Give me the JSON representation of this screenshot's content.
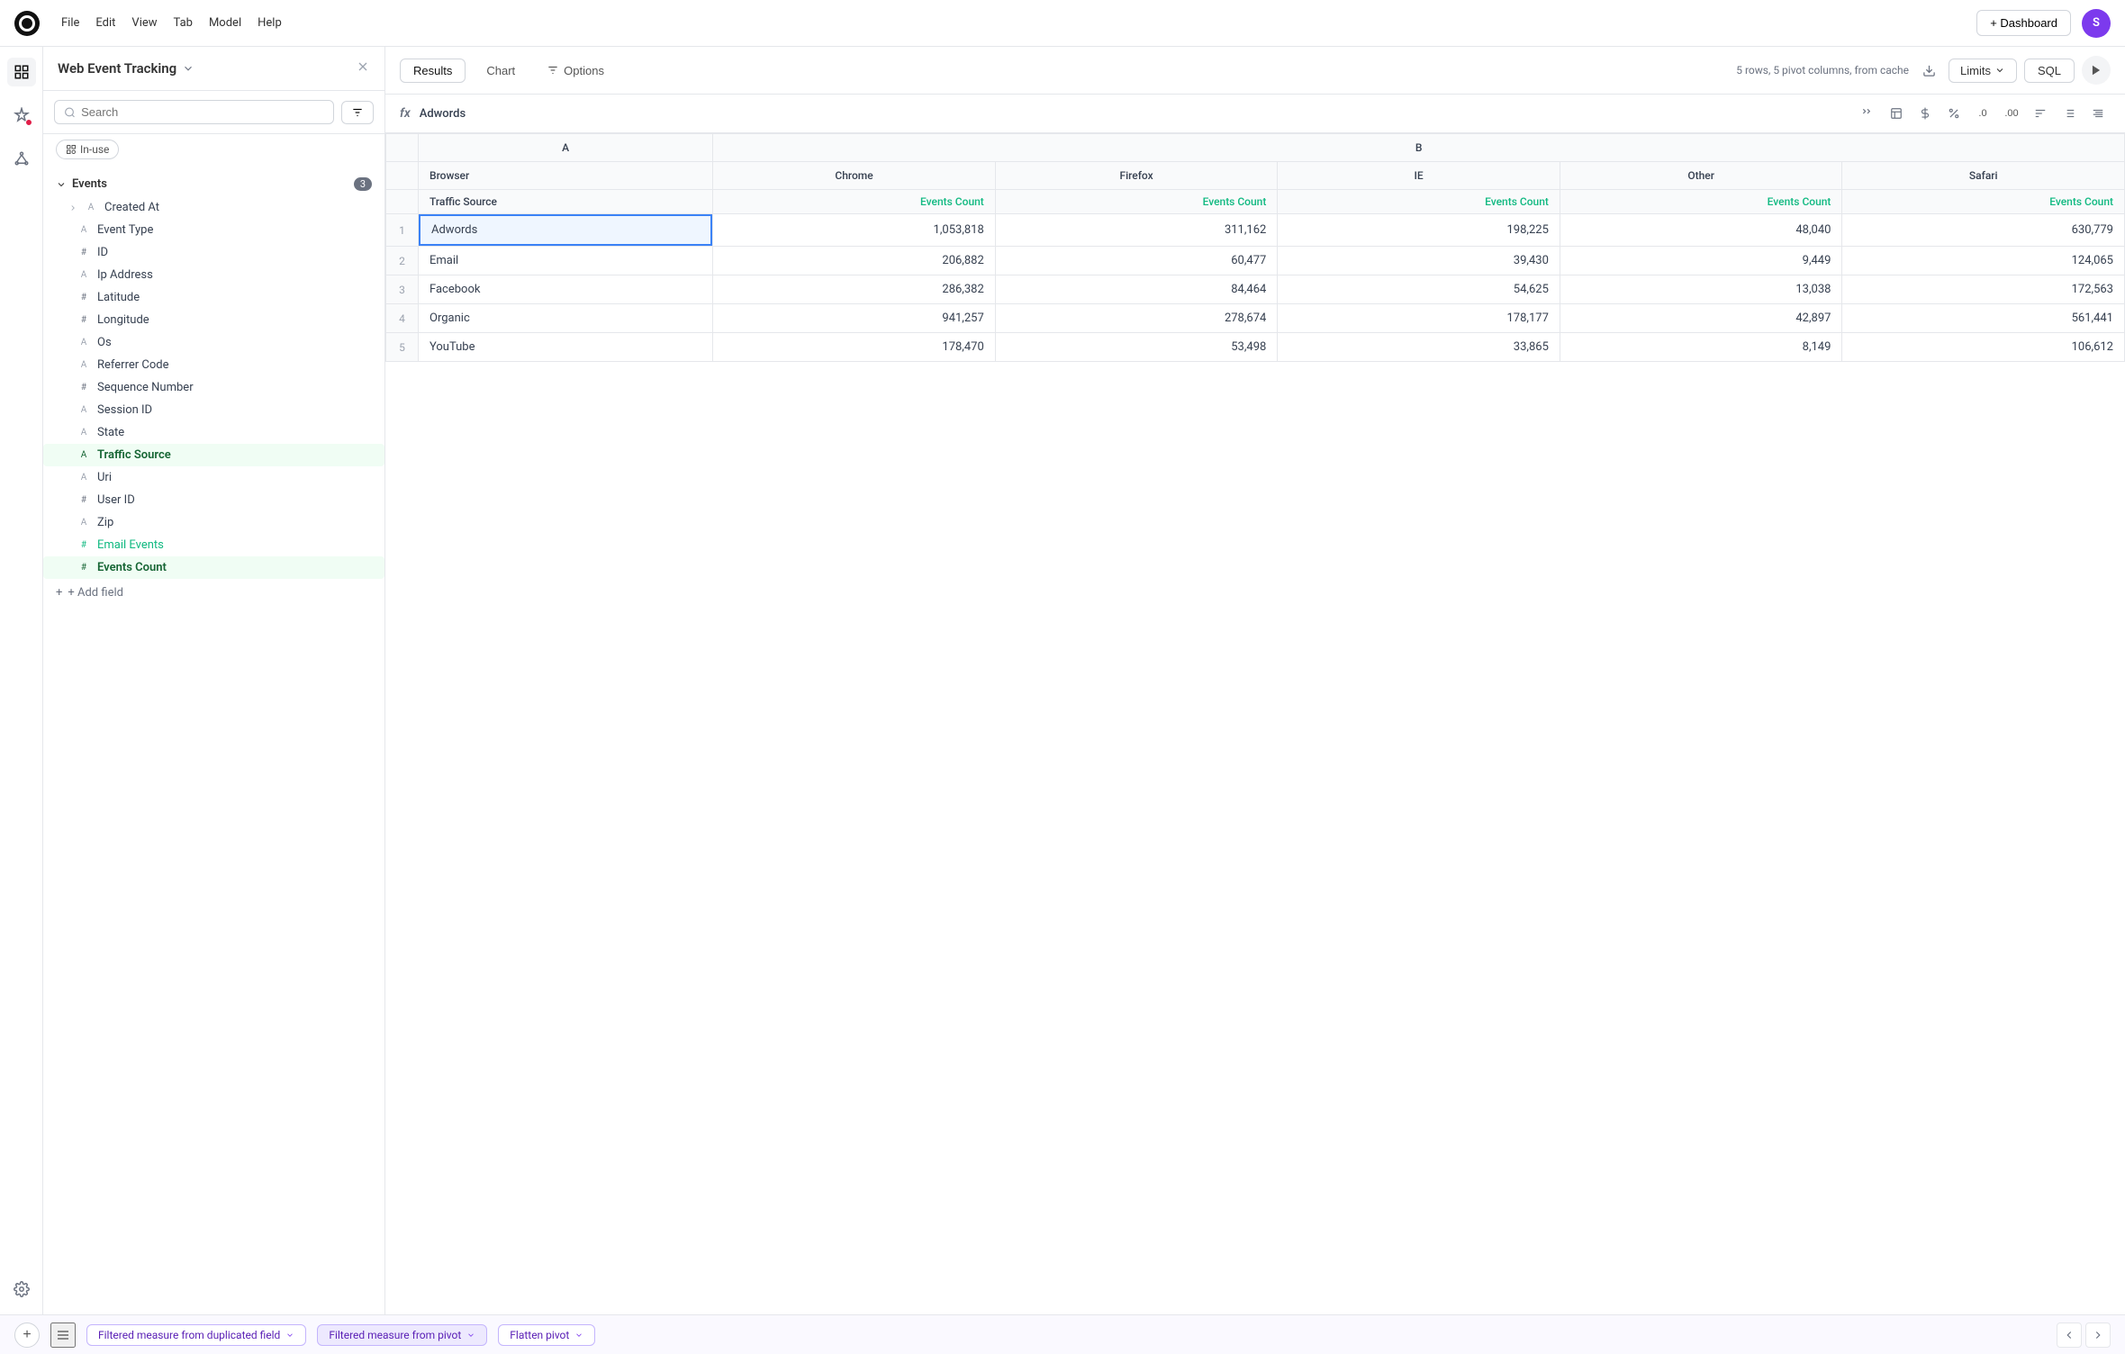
{
  "app": {
    "logo_initial": "○",
    "menu_items": [
      "File",
      "Edit",
      "View",
      "Tab",
      "Model",
      "Help"
    ],
    "add_dashboard_label": "+ Dashboard",
    "user_initial": "S"
  },
  "sidebar": {
    "title": "Web Event Tracking",
    "search_placeholder": "Search",
    "filter_label": "≡",
    "in_use_label": "In-use",
    "section_events": {
      "label": "Events",
      "count": "3",
      "fields": [
        {
          "type": "date",
          "name": "Created At",
          "active": false
        },
        {
          "type": "text",
          "name": "Event Type",
          "active": false
        },
        {
          "type": "hash",
          "name": "ID",
          "active": false
        },
        {
          "type": "text",
          "name": "Ip Address",
          "active": false
        },
        {
          "type": "hash",
          "name": "Latitude",
          "active": false
        },
        {
          "type": "hash",
          "name": "Longitude",
          "active": false
        },
        {
          "type": "text",
          "name": "Os",
          "active": false
        },
        {
          "type": "text",
          "name": "Referrer Code",
          "active": false
        },
        {
          "type": "hash",
          "name": "Sequence Number",
          "active": false
        },
        {
          "type": "text",
          "name": "Session ID",
          "active": false
        },
        {
          "type": "text",
          "name": "State",
          "active": false
        },
        {
          "type": "text",
          "name": "Traffic Source",
          "active": true,
          "class": "active"
        },
        {
          "type": "text",
          "name": "Uri",
          "active": false
        },
        {
          "type": "hash",
          "name": "User ID",
          "active": false
        },
        {
          "type": "text",
          "name": "Zip",
          "active": false
        },
        {
          "type": "hash",
          "name": "Email Events",
          "active": false,
          "class": "email-events"
        },
        {
          "type": "hash",
          "name": "Events Count",
          "active": true,
          "class": "measure-active"
        }
      ]
    },
    "add_field_label": "+ Add field"
  },
  "toolbar": {
    "results_label": "Results",
    "chart_label": "Chart",
    "options_label": "Options",
    "status_info": "5 rows, 5 pivot columns, from cache",
    "limits_label": "Limits",
    "sql_label": "SQL"
  },
  "formula_bar": {
    "icon": "fx",
    "value": "Adwords"
  },
  "table": {
    "col_a_label": "A",
    "col_b_label": "B",
    "row_header": {
      "dimension": "Browser",
      "sub_dimension": "Traffic Source",
      "pivot_columns": [
        "Chrome",
        "Firefox",
        "IE",
        "Other",
        "Safari"
      ],
      "measure_label": "Events Count"
    },
    "rows": [
      {
        "num": 1,
        "source": "Adwords",
        "chrome": "1,053,818",
        "firefox": "311,162",
        "ie": "198,225",
        "other": "48,040",
        "safari": "630,779"
      },
      {
        "num": 2,
        "source": "Email",
        "chrome": "206,882",
        "firefox": "60,477",
        "ie": "39,430",
        "other": "9,449",
        "safari": "124,065"
      },
      {
        "num": 3,
        "source": "Facebook",
        "chrome": "286,382",
        "firefox": "84,464",
        "ie": "54,625",
        "other": "13,038",
        "safari": "172,563"
      },
      {
        "num": 4,
        "source": "Organic",
        "chrome": "941,257",
        "firefox": "278,674",
        "ie": "178,177",
        "other": "42,897",
        "safari": "561,441"
      },
      {
        "num": 5,
        "source": "YouTube",
        "chrome": "178,470",
        "firefox": "53,498",
        "ie": "33,865",
        "other": "8,149",
        "safari": "106,612"
      }
    ]
  },
  "bottom_bar": {
    "tab1_label": "Filtered measure from duplicated field",
    "tab2_label": "Filtered measure from pivot",
    "tab3_label": "Flatten pivot"
  },
  "colors": {
    "accent_green": "#10b981",
    "accent_purple": "#7c3aed",
    "selected_blue": "#3b82f6",
    "active_bg": "#f0fdf4"
  }
}
